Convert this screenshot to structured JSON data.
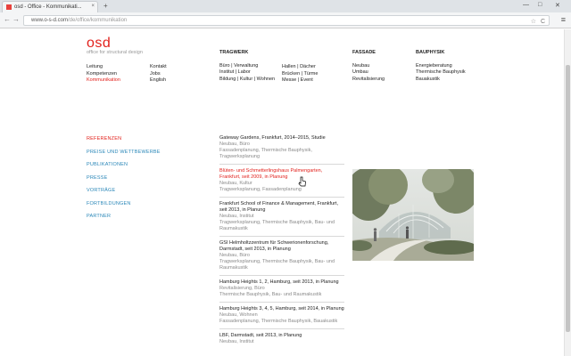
{
  "browser": {
    "tab_title": "osd - Office - Kommunikati...",
    "tab_close": "×",
    "new_tab": "+",
    "url_host": "www.o-s-d.com",
    "url_path": "/de/office/kommunikation",
    "back": "←",
    "forward": "→",
    "reload": "C",
    "star": "☆",
    "menu": "≡",
    "win_minimize": "—",
    "win_maximize": "□",
    "win_close": "✕"
  },
  "site": {
    "logo": "osd",
    "tagline": "office for structural design"
  },
  "topnav": {
    "col1": [
      "Leitung",
      "Kompetenzen",
      "Kommunikation"
    ],
    "col2": [
      "Kontakt",
      "Jobs",
      "English"
    ],
    "tragwerk_head": "TRAGWERK",
    "tragwerk_a": [
      "Büro | Verwaltung",
      "Institut | Labor",
      "Bildung | Kultur | Wohnen"
    ],
    "tragwerk_b": [
      "Hallen | Dächer",
      "Brücken | Türme",
      "Messe | Event"
    ],
    "fassade_head": "FASSADE",
    "fassade": [
      "Neubau",
      "Umbau",
      "Revitalisierung"
    ],
    "bauphysik_head": "BAUPHYSIK",
    "bauphysik": [
      "Energieberatung",
      "Thermische Bauphysik",
      "Bauakustik"
    ]
  },
  "sidenav": [
    "REFERENZEN",
    "PREISE UND WETTBEWERBE",
    "PUBLIKATIONEN",
    "PRESSE",
    "VORTRÄGE",
    "FORTBILDUNGEN",
    "PARTNER"
  ],
  "projects": [
    {
      "title": "Gateway Gardens, Frankfurt, 2014–2015, Studie",
      "sub": "Neubau, Büro\nFassadenplanung, Thermische Bauphysik,\nTragwerksplanung"
    },
    {
      "title": "Blüten- und Schmetterlingshaus Palmengarten, Frankfurt, seit 2009, in Planung",
      "sub": "Neubau, Kultur\nTragwerksplanung, Fassadenplanung"
    },
    {
      "title": "Frankfurt School of Finance & Management, Frankfurt, seit 2013, in Planung",
      "sub": "Neubau, Institut\nTragwerksplanung, Thermische Bauphysik, Bau- und Raumakustik"
    },
    {
      "title": "GSI Helmholtzzentrum für Schwerionenforschung, Darmstadt, seit 2013, in Planung",
      "sub": "Neubau, Büro\nTragwerksplanung, Thermische Bauphysik, Bau- und Raumakustik"
    },
    {
      "title": "Hamburg Heights 1, 2, Hamburg, seit 2013, in Planung",
      "sub": "Revitalisierung, Büro\nThermische Bauphysik, Bau- und Raumakustik"
    },
    {
      "title": "Hamburg Heights 3, 4, 5, Hamburg, seit 2014, in Planung",
      "sub": "Neubau, Wohnen\nFassadenplanung, Thermische Bauphysik, Bauakustik"
    },
    {
      "title": "LBF, Darmstadt, seit 2013, in Planung",
      "sub": "Neubau, Institut"
    }
  ],
  "colors": {
    "accent": "#e2211c",
    "link": "#2a87b8"
  }
}
